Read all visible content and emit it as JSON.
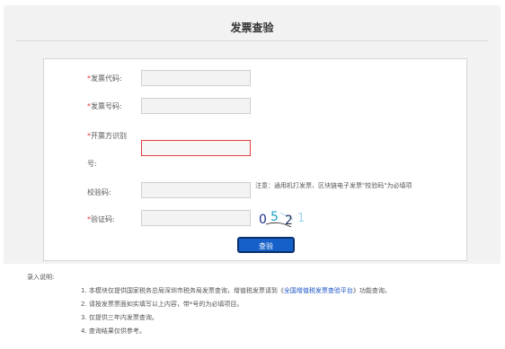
{
  "page": {
    "title": "发票查验"
  },
  "form": {
    "invoice_code": {
      "label": "发票代码:",
      "value": ""
    },
    "invoice_number": {
      "label": "发票号码:",
      "value": ""
    },
    "issuer_id": {
      "label_line1": "开票方识别",
      "label_line2": "号:",
      "value": ""
    },
    "check_code": {
      "label": "校验码:",
      "value": "",
      "note": "注意：通用机打发票、区块链电子发票\"校验码\"为必填项"
    },
    "captcha": {
      "label": "验证码:",
      "value": "",
      "image_text": [
        "0",
        "5",
        "2",
        "1"
      ]
    },
    "required_mark": "*",
    "submit_label": "查验",
    "error_color": "#e64040"
  },
  "instructions": {
    "title": "录入说明:",
    "items": [
      {
        "before": "1. 本模块仅提供国家税务总局深圳市税务局发票查询，增值税发票请到《",
        "link": "全国增值税发票查验平台",
        "after": "》功能查询。"
      },
      {
        "text": "2. 请按发票票面如实填写以上内容，带*号的为必填项目。"
      },
      {
        "text": "3. 仅提供三年内发票查询。"
      },
      {
        "text": "4. 查询结果仅供参考。"
      }
    ]
  }
}
